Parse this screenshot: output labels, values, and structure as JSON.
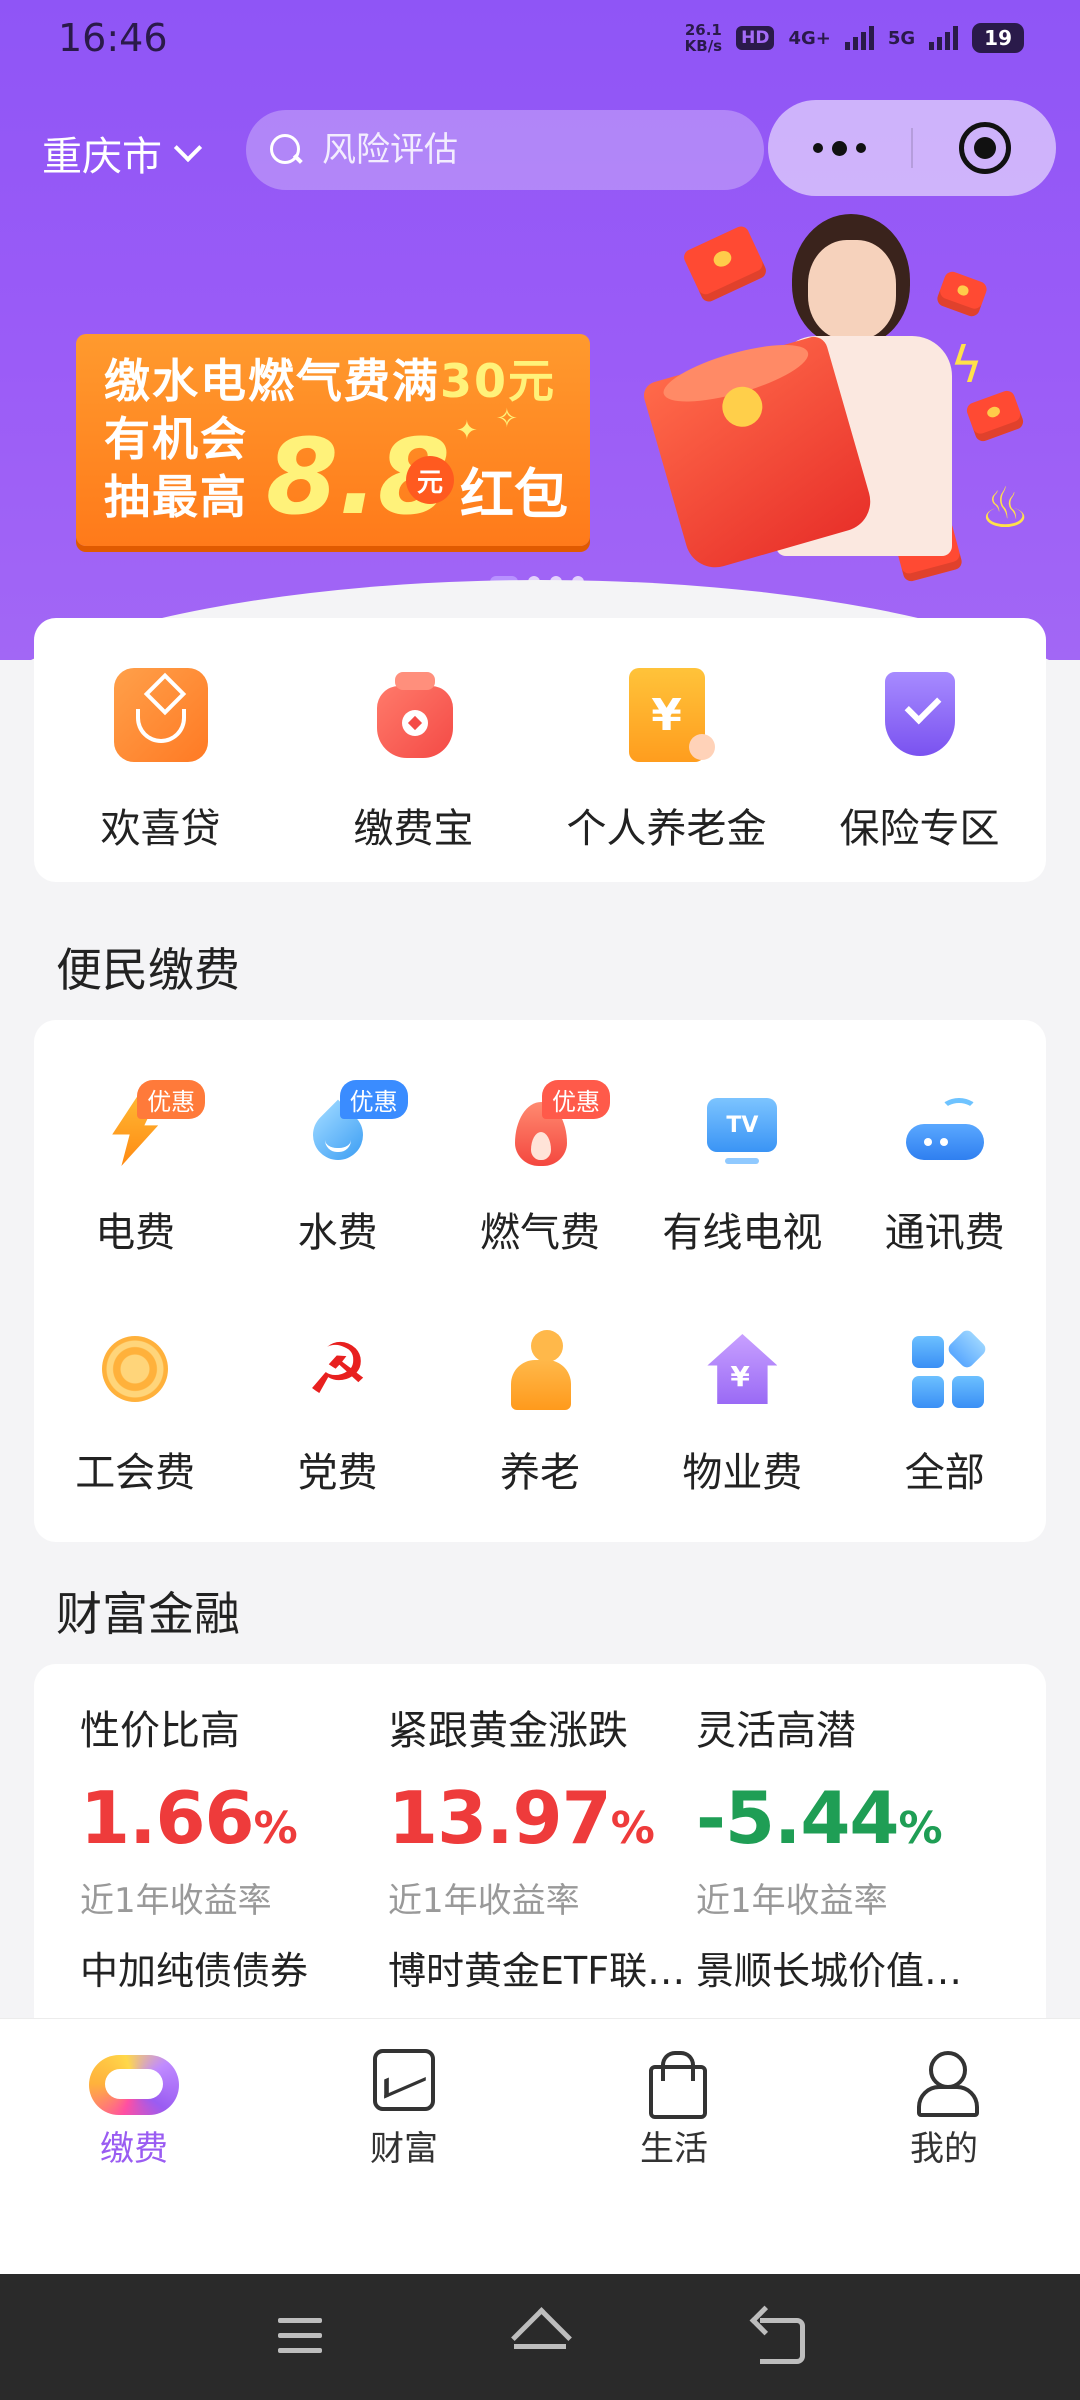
{
  "status_bar": {
    "time": "16:46",
    "net_speed_value": "26.1",
    "net_speed_unit": "KB/s",
    "hd_label": "HD",
    "network_4g": "4G+",
    "network_5g": "5G",
    "battery": "19"
  },
  "header": {
    "city": "重庆市",
    "search_placeholder": "风险评估"
  },
  "banner": {
    "line1_prefix": "缴水电燃气费满",
    "line1_amount": "30元",
    "line2": "有机会",
    "line3": "抽最高",
    "big_amount": "8.8",
    "yuan": "元",
    "red_packet": "红包",
    "slide_count": 4,
    "active_slide": 1
  },
  "quick_actions": [
    {
      "label": "欢喜贷",
      "icon": "loan-icon"
    },
    {
      "label": "缴费宝",
      "icon": "payment-bag-icon"
    },
    {
      "label": "个人养老金",
      "icon": "pension-yen-icon"
    },
    {
      "label": "保险专区",
      "icon": "insurance-shield-icon"
    }
  ],
  "services": {
    "title": "便民缴费",
    "items": [
      {
        "label": "电费",
        "icon": "electricity-icon",
        "tag": "优惠"
      },
      {
        "label": "水费",
        "icon": "water-drop-icon",
        "tag": "优惠"
      },
      {
        "label": "燃气费",
        "icon": "gas-flame-icon",
        "tag": "优惠"
      },
      {
        "label": "有线电视",
        "icon": "tv-icon"
      },
      {
        "label": "通讯费",
        "icon": "router-icon"
      },
      {
        "label": "工会费",
        "icon": "union-badge-icon"
      },
      {
        "label": "党费",
        "icon": "hammer-sickle-icon"
      },
      {
        "label": "养老",
        "icon": "elder-icon"
      },
      {
        "label": "物业费",
        "icon": "property-house-icon"
      },
      {
        "label": "全部",
        "icon": "all-grid-icon"
      }
    ]
  },
  "finance": {
    "title": "财富金融",
    "products": [
      {
        "headline": "性价比高",
        "rate": "1.66",
        "pct": "%",
        "rate_label": "近1年收益率",
        "name": "中加纯债债券",
        "trend": "up"
      },
      {
        "headline": "紧跟黄金涨跌",
        "rate": "13.97",
        "pct": "%",
        "rate_label": "近1年收益率",
        "name": "博时黄金ETF联…",
        "trend": "up"
      },
      {
        "headline": "灵活高潜",
        "rate": "-5.44",
        "pct": "%",
        "rate_label": "近1年收益率",
        "name": "景顺长城价值…",
        "trend": "down"
      }
    ]
  },
  "tabbar": {
    "items": [
      {
        "label": "缴费",
        "icon": "payment-cloud-icon",
        "active": true
      },
      {
        "label": "财富",
        "icon": "wealth-chart-icon",
        "active": false
      },
      {
        "label": "生活",
        "icon": "shopping-bag-icon",
        "active": false
      },
      {
        "label": "我的",
        "icon": "profile-icon",
        "active": false
      }
    ]
  },
  "colors": {
    "brand_purple": "#9b5cf7",
    "rate_up": "#ee3b3b",
    "rate_down": "#1f9e55",
    "banner_orange": "#ff7a1a"
  }
}
